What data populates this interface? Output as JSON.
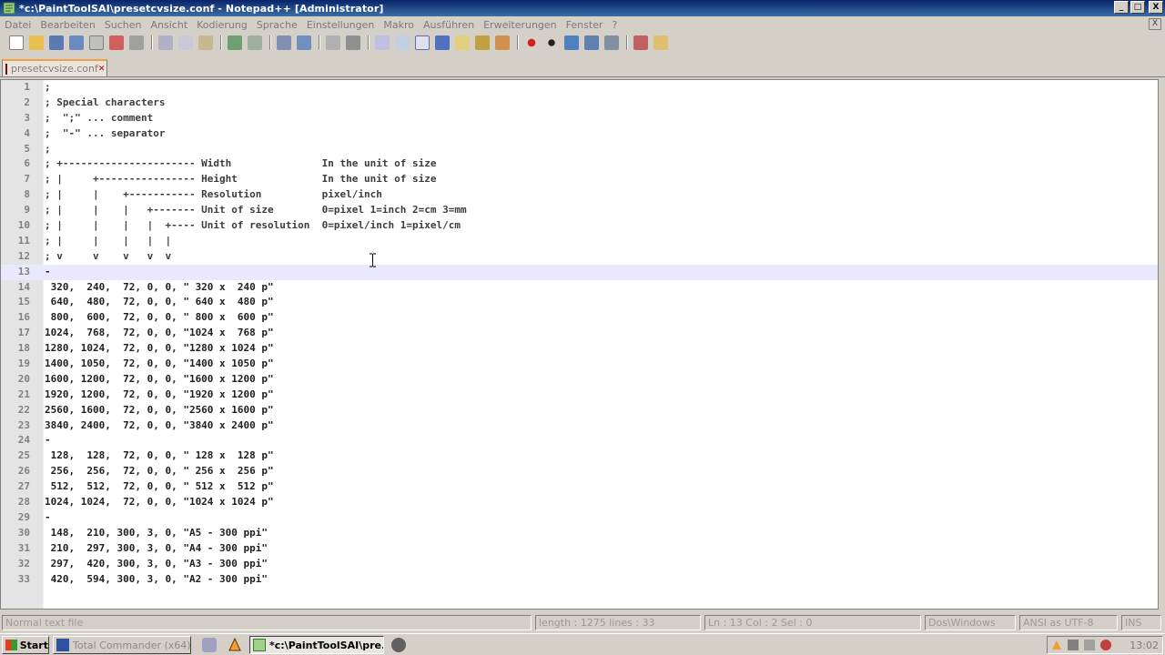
{
  "window": {
    "title": "*c:\\PaintToolSAI\\presetcvsize.conf - Notepad++ [Administrator]",
    "buttons": [
      "_",
      "□",
      "X"
    ]
  },
  "menu": {
    "items": [
      "Datei",
      "Bearbeiten",
      "Suchen",
      "Ansicht",
      "Kodierung",
      "Sprache",
      "Einstellungen",
      "Makro",
      "Ausführen",
      "Erweiterungen",
      "Fenster",
      "?"
    ],
    "close": "X"
  },
  "tab": {
    "label": "presetcvsize.conf",
    "close": "✕"
  },
  "editor": {
    "lines": [
      {
        "n": "1",
        "text": ";"
      },
      {
        "n": "2",
        "text": "; Special characters"
      },
      {
        "n": "3",
        "text": ";  \";\" ... comment"
      },
      {
        "n": "4",
        "text": ";  \"-\" ... separator"
      },
      {
        "n": "5",
        "text": ";"
      },
      {
        "n": "6",
        "text": "; +---------------------- Width               In the unit of size"
      },
      {
        "n": "7",
        "text": "; |     +---------------- Height              In the unit of size"
      },
      {
        "n": "8",
        "text": "; |     |    +----------- Resolution          pixel/inch"
      },
      {
        "n": "9",
        "text": "; |     |    |   +------- Unit of size        0=pixel 1=inch 2=cm 3=mm"
      },
      {
        "n": "10",
        "text": "; |     |    |   |  +---- Unit of resolution  0=pixel/inch 1=pixel/cm"
      },
      {
        "n": "11",
        "text": "; |     |    |   |  |"
      },
      {
        "n": "12",
        "text": "; v     v    v   v  v"
      },
      {
        "n": "13",
        "text": "-"
      },
      {
        "n": "14",
        "text": " 320,  240,  72, 0, 0, \" 320 x  240 p\""
      },
      {
        "n": "15",
        "text": " 640,  480,  72, 0, 0, \" 640 x  480 p\""
      },
      {
        "n": "16",
        "text": " 800,  600,  72, 0, 0, \" 800 x  600 p\""
      },
      {
        "n": "17",
        "text": "1024,  768,  72, 0, 0, \"1024 x  768 p\""
      },
      {
        "n": "18",
        "text": "1280, 1024,  72, 0, 0, \"1280 x 1024 p\""
      },
      {
        "n": "19",
        "text": "1400, 1050,  72, 0, 0, \"1400 x 1050 p\""
      },
      {
        "n": "20",
        "text": "1600, 1200,  72, 0, 0, \"1600 x 1200 p\""
      },
      {
        "n": "21",
        "text": "1920, 1200,  72, 0, 0, \"1920 x 1200 p\""
      },
      {
        "n": "22",
        "text": "2560, 1600,  72, 0, 0, \"2560 x 1600 p\""
      },
      {
        "n": "23",
        "text": "3840, 2400,  72, 0, 0, \"3840 x 2400 p\""
      },
      {
        "n": "24",
        "text": "-"
      },
      {
        "n": "25",
        "text": " 128,  128,  72, 0, 0, \" 128 x  128 p\""
      },
      {
        "n": "26",
        "text": " 256,  256,  72, 0, 0, \" 256 x  256 p\""
      },
      {
        "n": "27",
        "text": " 512,  512,  72, 0, 0, \" 512 x  512 p\""
      },
      {
        "n": "28",
        "text": "1024, 1024,  72, 0, 0, \"1024 x 1024 p\""
      },
      {
        "n": "29",
        "text": "-"
      },
      {
        "n": "30",
        "text": " 148,  210, 300, 3, 0, \"A5 - 300 ppi\""
      },
      {
        "n": "31",
        "text": " 210,  297, 300, 3, 0, \"A4 - 300 ppi\""
      },
      {
        "n": "32",
        "text": " 297,  420, 300, 3, 0, \"A3 - 300 ppi\""
      },
      {
        "n": "33",
        "text": " 420,  594, 300, 3, 0, \"A2 - 300 ppi\""
      }
    ],
    "current_line": "13"
  },
  "statusbar": {
    "file_type": "Normal text file",
    "length": "length : 1275   lines : 33",
    "position": "Ln : 13   Col : 2   Sel : 0",
    "eol": "Dos\\Windows",
    "encoding": "ANSI as UTF-8",
    "mode": "INS"
  },
  "taskbar": {
    "start_label": "Start",
    "tasks": [
      {
        "label": "Total Commander (x64)",
        "active": false
      },
      {
        "label": "*c:\\PaintToolSAI\\pre...",
        "active": true
      }
    ],
    "clock": "13:02"
  }
}
